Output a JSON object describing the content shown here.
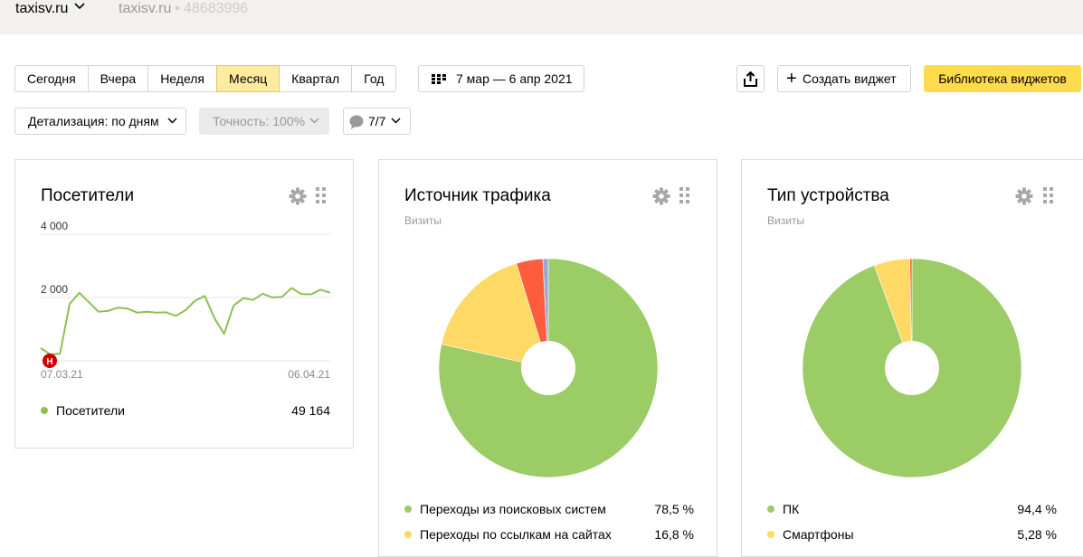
{
  "header": {
    "site": "taxisv.ru",
    "site_secondary": "taxisv.ru",
    "separator": "•",
    "counter_id": "48683996"
  },
  "toolbar": {
    "periods": [
      "Сегодня",
      "Вчера",
      "Неделя",
      "Месяц",
      "Квартал",
      "Год"
    ],
    "active_period": "Месяц",
    "date_range": "7 мар — 6 апр 2021",
    "create_widget": "Создать виджет",
    "widget_library": "Библиотека виджетов",
    "detail": "Детализация: по дням",
    "accuracy": "Точность: 100%",
    "notes": "7/7"
  },
  "icons": {
    "site_chevron": "chevron-down-icon",
    "calendar": "calendar-grid-icon",
    "share": "share-icon",
    "plus": "plus-icon",
    "gear": "gear-icon",
    "grip": "drag-handle-icon",
    "note_bubble": "speech-bubble-icon",
    "note_marker": "note-marker-icon"
  },
  "colors": {
    "accent_yellow": "#ffdb4d",
    "active_period_bg": "#ffeba0",
    "line_green": "#8cc152",
    "pie_green": "#9ccc65",
    "pie_yellow": "#ffd966",
    "pie_red": "#fd5c3d",
    "pie_blue": "#99a8d6",
    "note_red": "#cc0000"
  },
  "widgets": {
    "visitors": {
      "title": "Посетители",
      "legend_label": "Посетители",
      "legend_value": "49 164",
      "note_marker_label": "Н"
    },
    "traffic": {
      "title": "Источник трафика",
      "subtitle": "Визиты",
      "legend": [
        {
          "label": "Переходы из поисковых систем",
          "value": "78,5 %"
        },
        {
          "label": "Переходы по ссылкам на сайтах",
          "value": "16,8 %"
        }
      ]
    },
    "devices": {
      "title": "Тип устройства",
      "subtitle": "Визиты",
      "legend": [
        {
          "label": "ПК",
          "value": "94,4 %"
        },
        {
          "label": "Смартфоны",
          "value": "5,28 %"
        }
      ]
    }
  },
  "chart_data": [
    {
      "type": "line",
      "series": [
        {
          "name": "Посетители",
          "values": [
            400,
            200,
            220,
            1800,
            2150,
            1850,
            1550,
            1580,
            1680,
            1650,
            1520,
            1550,
            1520,
            1530,
            1420,
            1600,
            1900,
            2050,
            1350,
            850,
            1750,
            1980,
            1920,
            2120,
            2000,
            2020,
            2300,
            2110,
            2100,
            2250,
            2150
          ]
        }
      ],
      "x_labels": [
        "07.03.21",
        "06.04.21"
      ],
      "y_ticks": [
        "2 000",
        "4 000"
      ],
      "y_tick_values": [
        2000,
        4000
      ],
      "ylim": [
        0,
        4000
      ],
      "grid": true
    },
    {
      "type": "pie",
      "subtitle": "Визиты",
      "slices": [
        {
          "label": "Переходы из поисковых систем",
          "value": 78.5,
          "color": "#9ccc65"
        },
        {
          "label": "Переходы по ссылкам на сайтах",
          "value": 16.8,
          "color": "#ffd966"
        },
        {
          "value": 3.9,
          "color": "#fd5c3d"
        },
        {
          "value": 0.8,
          "color": "#99a8d6"
        }
      ]
    },
    {
      "type": "pie",
      "subtitle": "Визиты",
      "slices": [
        {
          "label": "ПК",
          "value": 94.4,
          "color": "#9ccc65"
        },
        {
          "label": "Смартфоны",
          "value": 5.28,
          "color": "#ffd966"
        },
        {
          "value": 0.32,
          "color": "#fd5c3d"
        }
      ]
    }
  ]
}
